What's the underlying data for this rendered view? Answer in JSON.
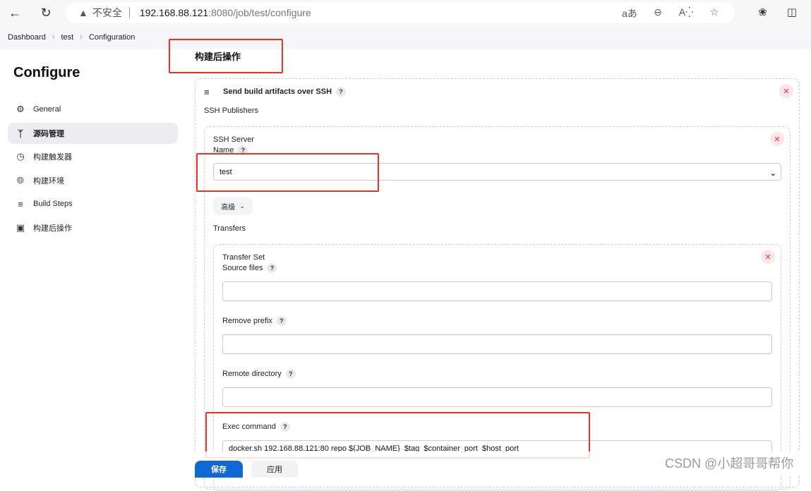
{
  "browser": {
    "back_icon": "arrow-left-icon",
    "reload_icon": "reload-icon",
    "security_warning": "不安全",
    "url_host": "192.168.88.121",
    "url_path": ":8080/job/test/configure",
    "toolbar_icons": [
      "translate-icon",
      "zoom-out-icon",
      "read-aloud-icon",
      "favorite-star-icon"
    ],
    "right_icons": [
      "extensions-icon",
      "split-screen-icon"
    ]
  },
  "breadcrumb": {
    "items": [
      "Dashboard",
      "test",
      "Configuration"
    ]
  },
  "sidebar": {
    "title": "Configure",
    "items": [
      {
        "label": "General",
        "icon": "gear-icon",
        "active": false
      },
      {
        "label": "源码管理",
        "icon": "branch-icon",
        "active": true
      },
      {
        "label": "构建触发器",
        "icon": "timer-icon",
        "active": false
      },
      {
        "label": "构建环境",
        "icon": "globe-icon",
        "active": false
      },
      {
        "label": "Build Steps",
        "icon": "list-icon",
        "active": false
      },
      {
        "label": "构建后操作",
        "icon": "package-icon",
        "active": false
      }
    ]
  },
  "main": {
    "section_title": "构建后操作",
    "publisher": {
      "title": "Send build artifacts over SSH",
      "subtitle": "SSH Publishers",
      "server": {
        "label_line1": "SSH Server",
        "label_line2": "Name",
        "selected": "test",
        "advanced_label": "高级"
      },
      "transfers_label": "Transfers",
      "transfer_set": {
        "title": "Transfer Set",
        "source_files_label": "Source files",
        "source_files_value": "",
        "remove_prefix_label": "Remove prefix",
        "remove_prefix_value": "",
        "remote_directory_label": "Remote directory",
        "remote_directory_value": "",
        "exec_command_label": "Exec command",
        "exec_command_value": "docker.sh 192.168.88.121:80 repo ${JOB_NAME}  $tag  $container_port  $host_port"
      }
    }
  },
  "footer": {
    "save_label": "保存",
    "apply_label": "应用"
  },
  "watermark": "CSDN @小超哥哥帮你",
  "colors": {
    "primary": "#1268d3",
    "annotation": "#e8332a",
    "danger_bg": "#fde5e8",
    "danger": "#e0354f"
  }
}
